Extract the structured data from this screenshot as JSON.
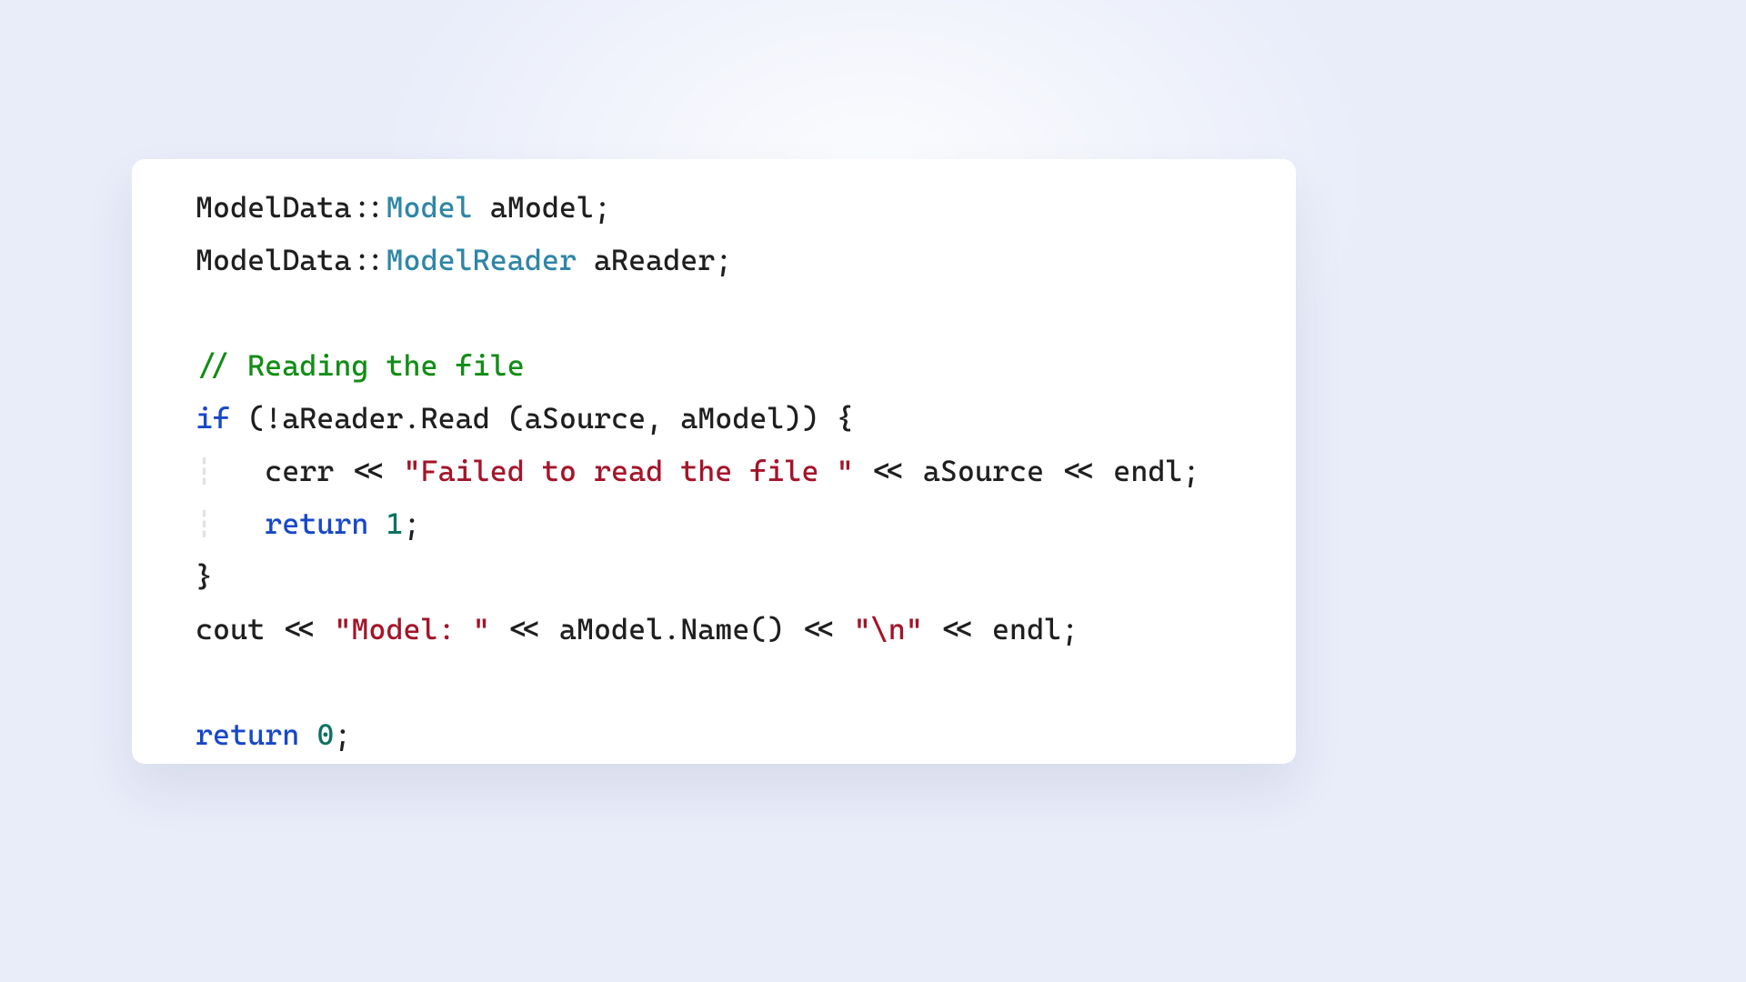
{
  "code": {
    "line1": {
      "ns": "ModelData::",
      "type": "Model",
      "rest": " aModel;"
    },
    "line2": {
      "ns": "ModelData::",
      "type": "ModelReader",
      "rest": " aReader;"
    },
    "line3": "",
    "line4": {
      "comment": "// Reading the file"
    },
    "line5": {
      "kw": "if",
      "cond": " (!aReader.Read (aSource, aModel)) {"
    },
    "line6": {
      "guide": "┆   ",
      "pre": "cerr << ",
      "str": "\"Failed to read the file \"",
      "post": " << aSource << endl;"
    },
    "line7": {
      "guide": "┆   ",
      "kw": "return",
      "sp": " ",
      "num": "1",
      "semi": ";"
    },
    "line8": {
      "brace": "}"
    },
    "line9": {
      "pre": "cout << ",
      "str1": "\"Model: \"",
      "mid1": " << aModel.Name() << ",
      "str2": "\"\\n\"",
      "mid2": " << endl;"
    },
    "line10": "",
    "line11": {
      "kw": "return",
      "sp": " ",
      "num": "0",
      "semi": ";"
    }
  },
  "colors": {
    "background": "#e9edfa",
    "card": "#ffffff",
    "type": "#2f86a6",
    "keyword": "#1848c7",
    "string": "#a3152a",
    "number": "#0b7261",
    "comment": "#138d17"
  }
}
